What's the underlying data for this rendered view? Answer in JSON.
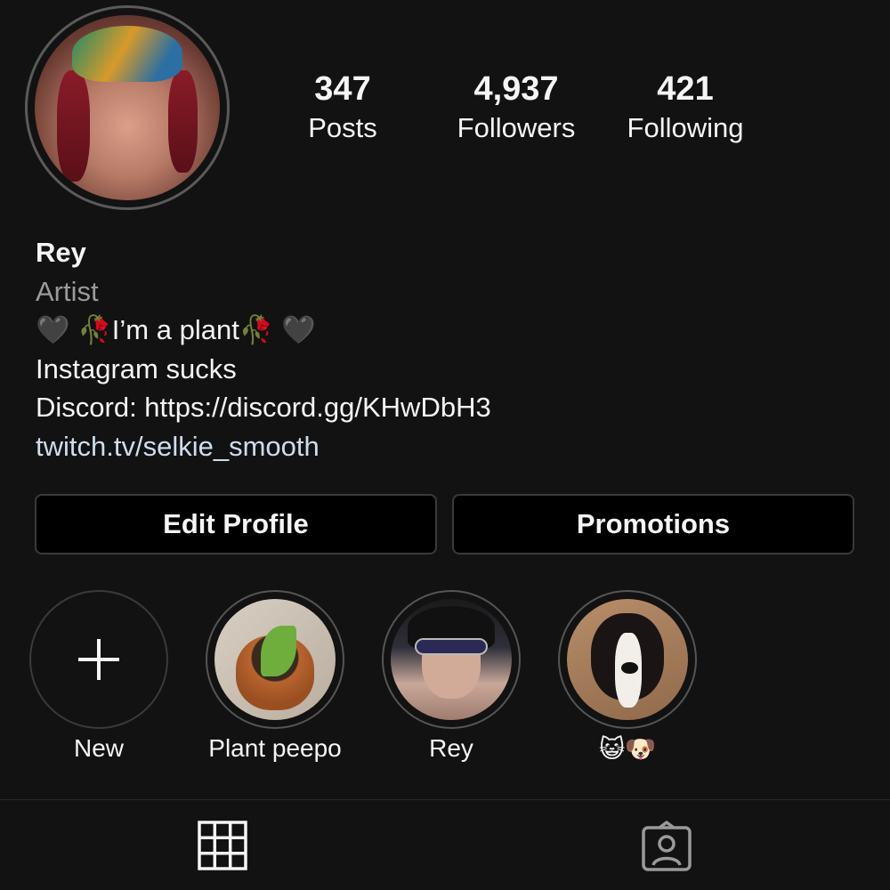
{
  "profile": {
    "stats": [
      {
        "value": "347",
        "label": "Posts"
      },
      {
        "value": "4,937",
        "label": "Followers"
      },
      {
        "value": "421",
        "label": "Following"
      }
    ],
    "bio": {
      "name": "Rey",
      "category": "Artist",
      "lines": [
        "🖤 🥀I’m a plant🥀 🖤",
        "Instagram sucks",
        "Discord: https://discord.gg/KHwDbH3"
      ],
      "link": "twitch.tv/selkie_smooth"
    }
  },
  "actions": {
    "edit_label": "Edit Profile",
    "promotions_label": "Promotions"
  },
  "highlights": [
    {
      "label": "New",
      "icon": "plus-icon"
    },
    {
      "label": "Plant peepo"
    },
    {
      "label": "Rey"
    },
    {
      "label": "😺🐶"
    }
  ],
  "tabs": [
    {
      "icon": "grid-icon",
      "selected": true
    },
    {
      "icon": "tagged-icon",
      "selected": false
    }
  ],
  "colors": {
    "background": "#121212",
    "text": "#f5f5f5",
    "muted": "#9a9a9a",
    "link": "#d0dced",
    "button_bg": "#000000",
    "border": "#3a3a3a"
  }
}
